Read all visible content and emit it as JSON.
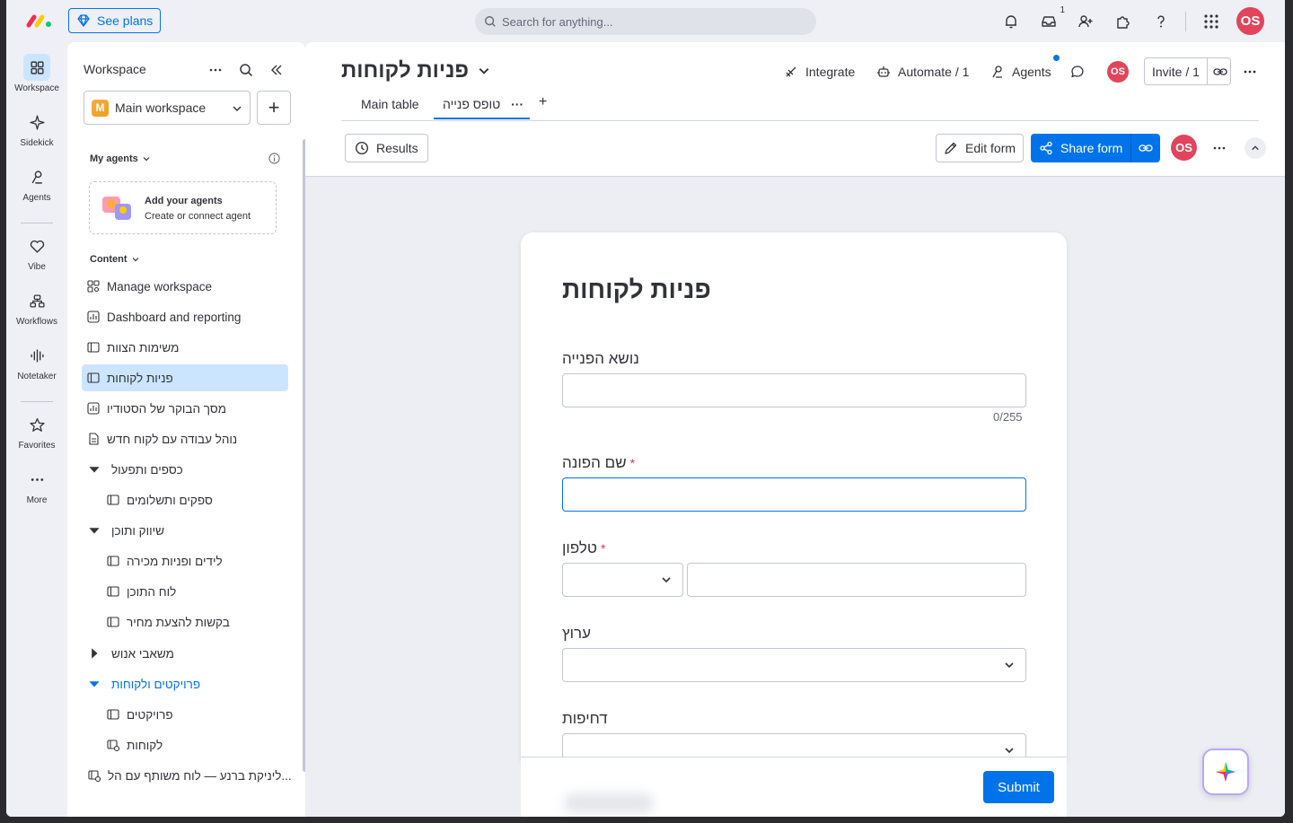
{
  "topbar": {
    "see_plans": "See plans",
    "search_placeholder": "Search for anything...",
    "inbox_count": "1",
    "user_initials": "OS"
  },
  "rail": {
    "items": [
      {
        "label": "Workspace",
        "icon": "grid-icon"
      },
      {
        "label": "Sidekick",
        "icon": "sparkle-icon"
      },
      {
        "label": "Agents",
        "icon": "agents-icon"
      },
      {
        "label": "Vibe",
        "icon": "heart-icon"
      },
      {
        "label": "Workflows",
        "icon": "workflows-icon"
      },
      {
        "label": "Notetaker",
        "icon": "waveform-icon"
      },
      {
        "label": "Favorites",
        "icon": "star-icon"
      },
      {
        "label": "More",
        "icon": "dots-icon"
      }
    ]
  },
  "sidebar": {
    "title": "Workspace",
    "workspace_name": "Main workspace",
    "workspace_letter": "M",
    "my_agents": "My agents",
    "agent_card_title": "Add your agents",
    "agent_card_sub": "Create or connect agent",
    "content": "Content",
    "items": [
      {
        "label": "Manage workspace",
        "icon": "manage-icon"
      },
      {
        "label": "Dashboard and reporting",
        "icon": "dashboard-icon"
      },
      {
        "label": "משימות הצוות",
        "icon": "board-icon"
      },
      {
        "label": "פניות לקוחות",
        "icon": "board-icon",
        "active": true
      },
      {
        "label": "מסך הבוקר של הסטודיו",
        "icon": "dashboard-icon"
      },
      {
        "label": "נוהל עבודה עם לקוח חדש",
        "icon": "doc-icon"
      },
      {
        "label": "כספים ותפעול",
        "icon": "folder-open"
      },
      {
        "label": "ספקים ותשלומים",
        "icon": "board-icon"
      },
      {
        "label": "שיווק ותוכן",
        "icon": "folder-open"
      },
      {
        "label": "לידים ופניות מכירה",
        "icon": "board-icon"
      },
      {
        "label": "לוח התוכן",
        "icon": "board-icon"
      },
      {
        "label": "בקשות להצעת מחיר",
        "icon": "board-icon"
      },
      {
        "label": "משאבי אנוש",
        "icon": "folder-closed"
      },
      {
        "label": "פרויקטים ולקוחות",
        "icon": "folder-open"
      },
      {
        "label": "פרויקטים",
        "icon": "board-icon"
      },
      {
        "label": "לקוחות",
        "icon": "shared-board-icon"
      },
      {
        "label": "ליניקת ברנע — לוח משותף עם הל...",
        "icon": "shared-board-icon"
      }
    ]
  },
  "board": {
    "title": "פניות לקוחות",
    "integrate": "Integrate",
    "automate": "Automate / 1",
    "agents": "Agents",
    "invite": "Invite / 1",
    "tabs": [
      "Main table",
      "טופס פנייה"
    ],
    "results": "Results",
    "edit_form": "Edit form",
    "share_form": "Share form"
  },
  "form": {
    "title": "פניות לקוחות",
    "fields": [
      {
        "label": "נושא הפנייה",
        "required": false,
        "counter": "0/255"
      },
      {
        "label": "שם הפונה",
        "required": true
      },
      {
        "label": "טלפון",
        "required": true
      },
      {
        "label": "ערוץ",
        "required": false
      },
      {
        "label": "דחיפות",
        "required": false
      }
    ],
    "required_mark": "*",
    "submit": "Submit"
  },
  "colors": {
    "accent": "#0073ea",
    "avatar": "#e2445c",
    "active_nav": "#cce5ff",
    "required": "#d83a52"
  }
}
